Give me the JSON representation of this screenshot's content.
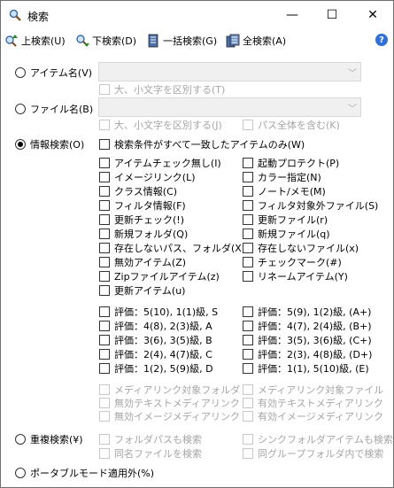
{
  "window": {
    "title": "検索",
    "minimize_glyph": "—",
    "maximize_glyph": "☐",
    "close_glyph": "✕"
  },
  "toolbar": {
    "search_up": "上検索(U)",
    "search_down": "下検索(D)",
    "batch_search": "一括検索(G)",
    "all_search": "全検索(A)",
    "help_glyph": "?"
  },
  "modes": {
    "item_name": "アイテム名(V)",
    "file_name": "ファイル名(B)",
    "info_search": "情報検索(O)",
    "dup_search": "重複検索(¥)",
    "portable": "ポータブルモード適用外(%)"
  },
  "item_name_opts": {
    "case": "大、小文字を区別する(T)"
  },
  "file_name_opts": {
    "case": "大、小文字を区別する(J)",
    "full_path": "パス全体を含む(K)"
  },
  "info": {
    "all_match": "検索条件がすべて一致したアイテムのみ(W)",
    "left": [
      "アイテムチェック無し(I)",
      "イメージリンク(L)",
      "クラス情報(C)",
      "フィルタ情報(F)",
      "更新チェック(!)",
      "新規フォルダ(Q)",
      "存在しないパス、フォルダ(X)",
      "無効アイテム(Z)",
      "Zipファイルアイテム(z)",
      "更新アイテム(u)"
    ],
    "right": [
      "起動プロテクト(P)",
      "カラー指定(N)",
      "ノート/メモ(M)",
      "フィルタ対象外ファイル(S)",
      "更新ファイル(r)",
      "新規ファイル(q)",
      "存在しないファイル(x)",
      "チェックマーク(#)",
      "リネームアイテム(Y)"
    ],
    "ratings_left": [
      "評価：5(10), 1(1)級, S",
      "評価：4(8), 2(3)級, A",
      "評価：3(6), 3(5)級, B",
      "評価：2(4), 4(7)級, C",
      "評価：1(2), 5(9)級, D"
    ],
    "ratings_right": [
      "評価：5(9), 1(2)級, (A+)",
      "評価：4(7), 2(4)級, (B+)",
      "評価：3(5), 3(6)級, (C+)",
      "評価：2(3), 4(8)級, (D+)",
      "評価：1(1), 5(10)級, (E)"
    ],
    "media_left": [
      "メディアリンク対象フォルダ",
      "無効テキストメディアリンク",
      "無効イメージメディアリンク"
    ],
    "media_right": [
      "メディアリンク対象ファイル",
      "有効テキストメディアリンク",
      "有効イメージメディアリンク"
    ]
  },
  "dup": {
    "folder_path": "フォルダパスも検索",
    "same_name": "同名ファイルを検索",
    "shortcut_folder": "シンクフォルダアイテムも検索",
    "same_group": "同グループフォルダ内で検索"
  },
  "colors": {
    "disabled_text": "#a5a5a5",
    "help_blue": "#2f6fd6"
  }
}
